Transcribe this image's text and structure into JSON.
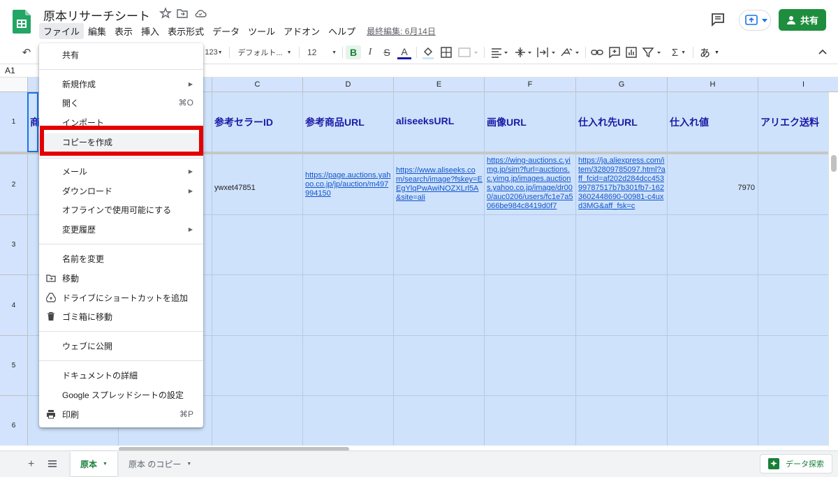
{
  "doc": {
    "title": "原本リサーチシート",
    "last_edit": "最終編集: 6月14日"
  },
  "menubar": [
    {
      "label": "ファイル",
      "active": true
    },
    {
      "label": "編集"
    },
    {
      "label": "表示"
    },
    {
      "label": "挿入"
    },
    {
      "label": "表示形式"
    },
    {
      "label": "データ"
    },
    {
      "label": "ツール"
    },
    {
      "label": "アドオン"
    },
    {
      "label": "ヘルプ"
    }
  ],
  "header_buttons": {
    "share": "共有"
  },
  "toolbar": {
    "number_format": "123",
    "font": "デフォルト...",
    "font_size": "12",
    "bold": "B",
    "italic": "I",
    "strike": "S",
    "text_color": "A",
    "input_tools": "あ"
  },
  "formula_bar": {
    "cell_ref": "A1"
  },
  "grid": {
    "columns": [
      "C",
      "D",
      "E",
      "F",
      "G",
      "H",
      "I"
    ],
    "rows": [
      "1",
      "2",
      "3",
      "4",
      "5",
      "6"
    ],
    "row1": {
      "a": "商",
      "c": "参考セラーID",
      "d": "参考商品URL",
      "e": "aliseeksURL",
      "f": "画像URL",
      "g": "仕入れ先URL",
      "h": "仕入れ値",
      "i": "アリエク送料"
    },
    "row2": {
      "c": "ywxet47851",
      "d": "https://page.auctions.yahoo.co.jp/jp/auction/m497994150",
      "e": "https://www.aliseeks.com/search/image?fskey=EEgYlqPwAwiNOZXLrl5A&site=ali",
      "f": "https://wing-auctions.c.yimg.jp/sim?furl=auctions.c.yimg.jp/images.auctions.yahoo.co.jp/image/dr000/auc0206/users/fc1e7a5066be984c8419d0f7",
      "g": "https://ja.aliexpress.com/item/32809785097.html?aff_fcid=af202d284dcc45399787517b7b301fb7-1623602448690-00981-c4uxd3MG&aff_fsk=c",
      "h": "7970"
    }
  },
  "file_menu": {
    "items": [
      {
        "label": "共有"
      },
      {
        "label": "新規作成",
        "submenu": true
      },
      {
        "label": "開く",
        "shortcut": "⌘O"
      },
      {
        "label": "インポート"
      },
      {
        "label": "コピーを作成",
        "highlighted": true
      },
      {
        "label": "メール",
        "submenu": true
      },
      {
        "label": "ダウンロード",
        "submenu": true
      },
      {
        "label": "オフラインで使用可能にする"
      },
      {
        "label": "変更履歴",
        "submenu": true
      },
      {
        "label": "名前を変更"
      },
      {
        "label": "移動",
        "icon": "folder-move-icon"
      },
      {
        "label": "ドライブにショートカットを追加",
        "icon": "drive-shortcut-icon"
      },
      {
        "label": "ゴミ箱に移動",
        "icon": "trash-icon"
      },
      {
        "label": "ウェブに公開"
      },
      {
        "label": "ドキュメントの詳細"
      },
      {
        "label": "Google スプレッドシートの設定"
      },
      {
        "label": "印刷",
        "icon": "print-icon",
        "shortcut": "⌘P"
      }
    ]
  },
  "sheets": [
    {
      "name": "原本",
      "active": true
    },
    {
      "name": "原本 のコピー",
      "active": false
    }
  ],
  "explore": "データ探索",
  "colors": {
    "brand_green": "#1e8e3e",
    "selection": "#cfe2fb",
    "highlight_red": "#e30000",
    "link": "#1155cc"
  }
}
